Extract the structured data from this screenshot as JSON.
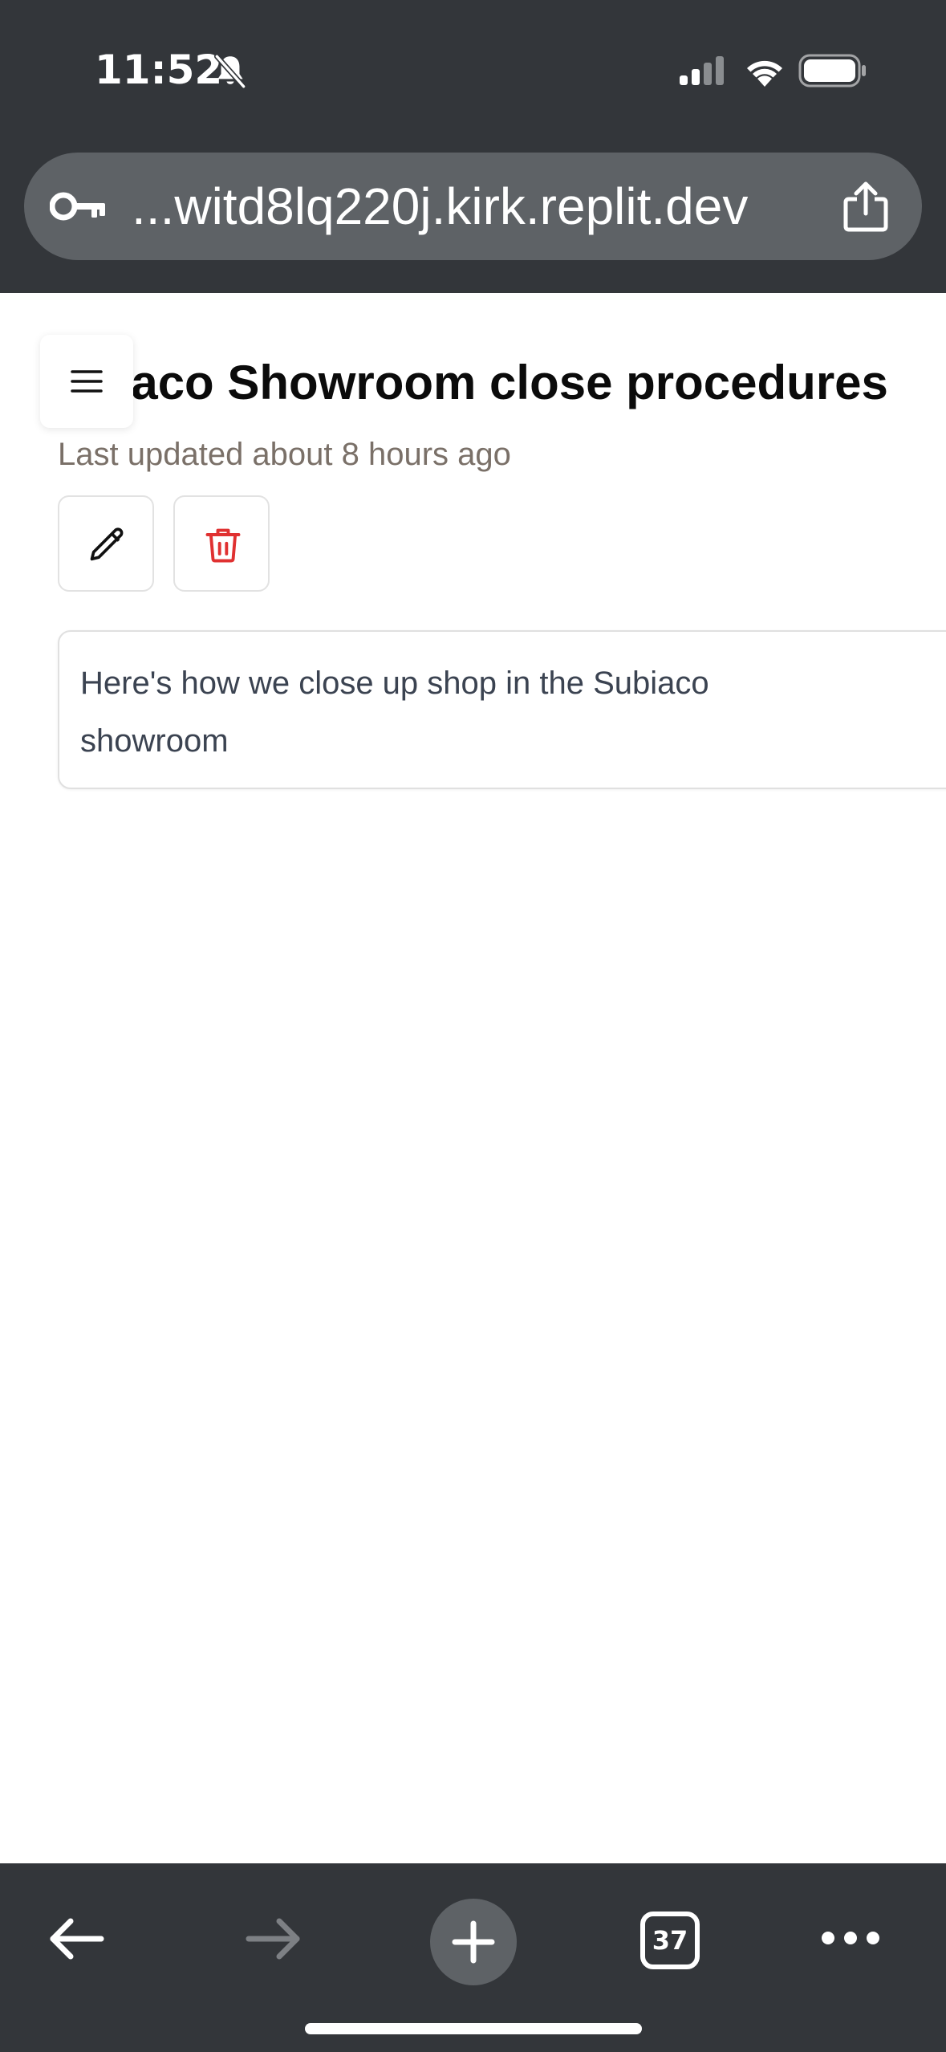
{
  "status_bar": {
    "time": "11:52",
    "icons": [
      "bell-slash-icon",
      "cellular-signal-icon",
      "wifi-icon",
      "battery-icon"
    ]
  },
  "browser": {
    "url": "...witd8lq220j.kirk.replit.dev",
    "url_icon": "key-icon",
    "share_icon": "share-icon",
    "toolbar": {
      "back_icon": "arrow-left-icon",
      "forward_icon": "arrow-right-icon",
      "new_tab_icon": "plus-icon",
      "tab_count": "37",
      "more_icon": "ellipsis-icon"
    }
  },
  "page": {
    "menu_icon": "hamburger-menu-icon",
    "title_visible": "biaco Showroom close procedures",
    "last_updated": "Last updated about 8 hours ago",
    "actions": {
      "edit_icon": "pencil-icon",
      "delete_icon": "trash-icon"
    },
    "description": "Here's how we close up shop in the Subiaco showroom"
  },
  "colors": {
    "chrome_background": "#33363a",
    "url_bar_background": "#5e6266",
    "delete_red": "#e03131",
    "muted_text": "#7a7068",
    "body_text": "#3b4351"
  }
}
